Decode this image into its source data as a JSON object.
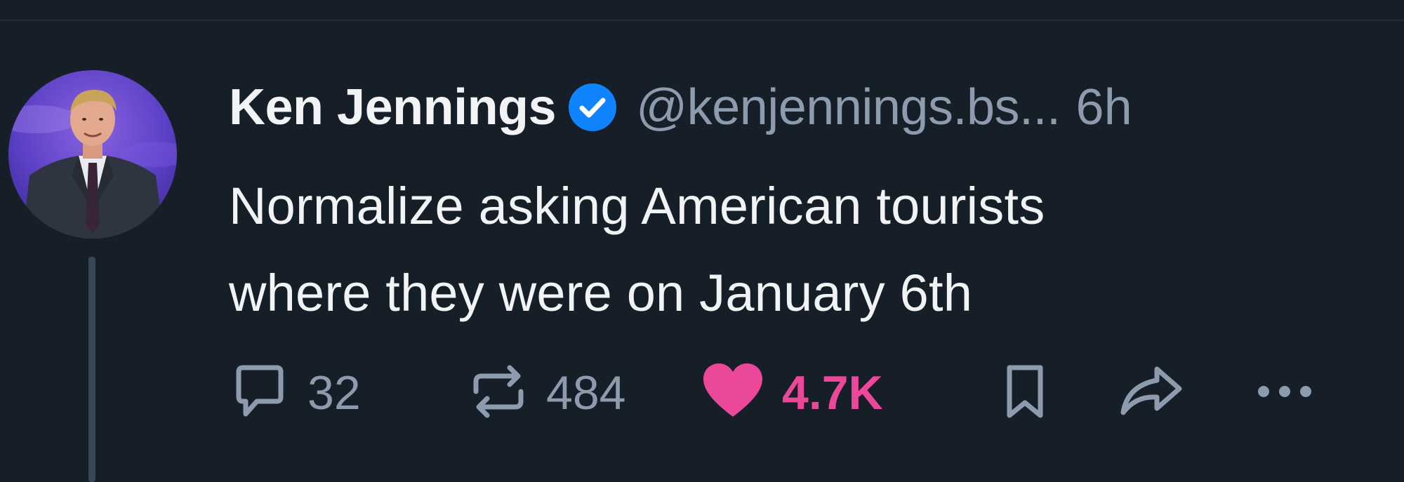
{
  "post": {
    "author": {
      "display_name": "Ken Jennings",
      "handle": "@kenjennings.bs...",
      "verified": true,
      "avatar_icon": "avatar-photo"
    },
    "time_ago": "6h",
    "text_lines": [
      "Normalize asking American tourists",
      "where they were on January 6th"
    ],
    "actions": {
      "reply": {
        "icon": "comment-icon",
        "count": "32"
      },
      "repost": {
        "icon": "repost-icon",
        "count": "484"
      },
      "like": {
        "icon": "heart-icon",
        "count": "4.7K",
        "liked": true
      },
      "bookmark": {
        "icon": "bookmark-icon"
      },
      "share": {
        "icon": "share-icon"
      },
      "more": {
        "icon": "more-icon"
      }
    }
  },
  "colors": {
    "background": "#161e27",
    "text_primary": "#f1f3f5",
    "text_muted": "#8c9bad",
    "like_pink": "#ec4899",
    "verified_blue": "#1083fe",
    "thread_line": "#3a4756"
  }
}
